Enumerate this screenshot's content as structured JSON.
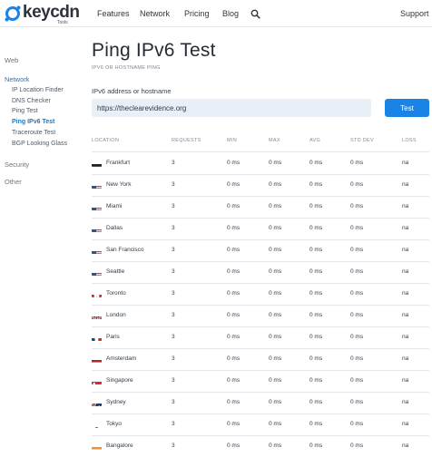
{
  "brand": {
    "name": "keycdn",
    "tagline": "Tools"
  },
  "nav": {
    "features": "Features",
    "network": "Network",
    "pricing": "Pricing",
    "blog": "Blog",
    "support": "Support"
  },
  "sidebar": {
    "web": "Web",
    "network": "Network",
    "network_items": [
      "IP Location Finder",
      "DNS Checker",
      "Ping Test",
      "Ping IPv6 Test",
      "Traceroute Test",
      "BGP Looking Glass"
    ],
    "active_item": "Ping IPv6 Test",
    "security": "Security",
    "other": "Other"
  },
  "page": {
    "title": "Ping IPv6 Test",
    "subtitle": "IPV6 OR HOSTNAME PING",
    "field_label": "IPv6 address or hostname",
    "field_value": "https://theclearevidence.org",
    "test_button": "Test"
  },
  "table": {
    "headers": [
      "LOCATION",
      "REQUESTS",
      "MIN",
      "MAX",
      "AVG",
      "STD DEV",
      "LOSS"
    ],
    "rows": [
      {
        "flag": "de",
        "location": "Frankfurt",
        "requests": "3",
        "min": "0 ms",
        "max": "0 ms",
        "avg": "0 ms",
        "stddev": "0 ms",
        "loss": "na"
      },
      {
        "flag": "us",
        "location": "New York",
        "requests": "3",
        "min": "0 ms",
        "max": "0 ms",
        "avg": "0 ms",
        "stddev": "0 ms",
        "loss": "na"
      },
      {
        "flag": "us",
        "location": "Miami",
        "requests": "3",
        "min": "0 ms",
        "max": "0 ms",
        "avg": "0 ms",
        "stddev": "0 ms",
        "loss": "na"
      },
      {
        "flag": "us",
        "location": "Dallas",
        "requests": "3",
        "min": "0 ms",
        "max": "0 ms",
        "avg": "0 ms",
        "stddev": "0 ms",
        "loss": "na"
      },
      {
        "flag": "us",
        "location": "San Francisco",
        "requests": "3",
        "min": "0 ms",
        "max": "0 ms",
        "avg": "0 ms",
        "stddev": "0 ms",
        "loss": "na"
      },
      {
        "flag": "us",
        "location": "Seattle",
        "requests": "3",
        "min": "0 ms",
        "max": "0 ms",
        "avg": "0 ms",
        "stddev": "0 ms",
        "loss": "na"
      },
      {
        "flag": "ca",
        "location": "Toronto",
        "requests": "3",
        "min": "0 ms",
        "max": "0 ms",
        "avg": "0 ms",
        "stddev": "0 ms",
        "loss": "na"
      },
      {
        "flag": "gb",
        "location": "London",
        "requests": "3",
        "min": "0 ms",
        "max": "0 ms",
        "avg": "0 ms",
        "stddev": "0 ms",
        "loss": "na"
      },
      {
        "flag": "fr",
        "location": "Paris",
        "requests": "3",
        "min": "0 ms",
        "max": "0 ms",
        "avg": "0 ms",
        "stddev": "0 ms",
        "loss": "na"
      },
      {
        "flag": "nl",
        "location": "Amsterdam",
        "requests": "3",
        "min": "0 ms",
        "max": "0 ms",
        "avg": "0 ms",
        "stddev": "0 ms",
        "loss": "na"
      },
      {
        "flag": "sg",
        "location": "Singapore",
        "requests": "3",
        "min": "0 ms",
        "max": "0 ms",
        "avg": "0 ms",
        "stddev": "0 ms",
        "loss": "na"
      },
      {
        "flag": "au",
        "location": "Sydney",
        "requests": "3",
        "min": "0 ms",
        "max": "0 ms",
        "avg": "0 ms",
        "stddev": "0 ms",
        "loss": "na"
      },
      {
        "flag": "jp",
        "location": "Tokyo",
        "requests": "3",
        "min": "0 ms",
        "max": "0 ms",
        "avg": "0 ms",
        "stddev": "0 ms",
        "loss": "na"
      },
      {
        "flag": "in",
        "location": "Bangalore",
        "requests": "3",
        "min": "0 ms",
        "max": "0 ms",
        "avg": "0 ms",
        "stddev": "0 ms",
        "loss": "na"
      }
    ]
  },
  "colors": {
    "accent": "#1a84e6",
    "active_link": "#1b78c8",
    "input_bg": "#e9eff7"
  }
}
